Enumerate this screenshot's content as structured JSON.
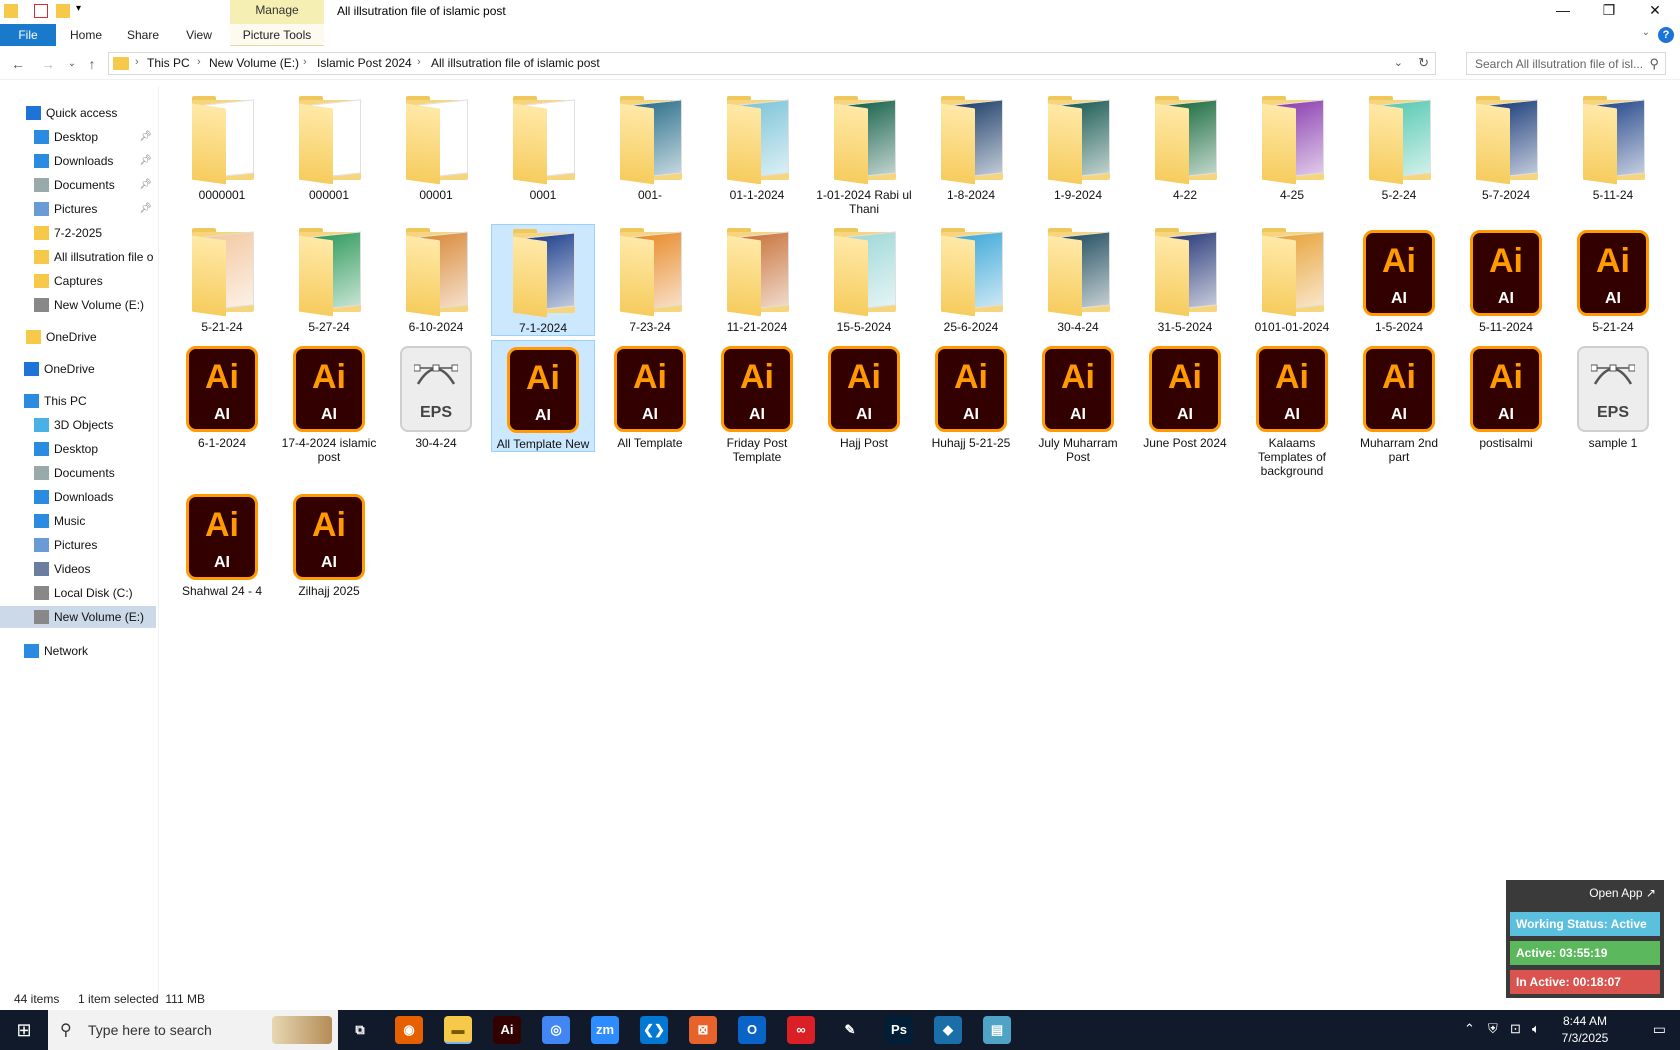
{
  "window": {
    "title": "All illsutration file of islamic post",
    "manage_tab": "Manage",
    "picture_tools": "Picture Tools",
    "minimize": "—",
    "restore": "❐",
    "close": "✕"
  },
  "ribbon": {
    "tabs": [
      "File",
      "Home",
      "Share",
      "View"
    ],
    "help": "?"
  },
  "address": {
    "crumbs": [
      "This PC",
      "New Volume (E:)",
      "Islamic Post 2024",
      "All illsutration file of islamic post"
    ],
    "search_placeholder": "Search All illsutration file of isl..."
  },
  "sidebar": {
    "items": [
      {
        "label": "Quick access",
        "icon": "star-icon",
        "pinned": false
      },
      {
        "label": "Desktop",
        "icon": "desktop-icon",
        "pinned": true
      },
      {
        "label": "Downloads",
        "icon": "download-icon",
        "pinned": true
      },
      {
        "label": "Documents",
        "icon": "documents-icon",
        "pinned": true
      },
      {
        "label": "Pictures",
        "icon": "pictures-icon",
        "pinned": true
      },
      {
        "label": "7-2-2025",
        "icon": "folder-icon",
        "pinned": false
      },
      {
        "label": "All illsutration file o",
        "icon": "folder-icon",
        "pinned": false
      },
      {
        "label": "Captures",
        "icon": "folder-icon",
        "pinned": false
      },
      {
        "label": "New Volume (E:)",
        "icon": "drive-icon",
        "pinned": false
      },
      {
        "label": "OneDrive",
        "icon": "folder-icon",
        "pinned": false
      },
      {
        "label": "OneDrive",
        "icon": "cloud-icon",
        "pinned": false
      },
      {
        "label": "This PC",
        "icon": "computer-icon",
        "pinned": false
      },
      {
        "label": "3D Objects",
        "icon": "cube-icon",
        "pinned": false
      },
      {
        "label": "Desktop",
        "icon": "desktop-icon",
        "pinned": false
      },
      {
        "label": "Documents",
        "icon": "documents-icon",
        "pinned": false
      },
      {
        "label": "Downloads",
        "icon": "download-icon",
        "pinned": false
      },
      {
        "label": "Music",
        "icon": "music-icon",
        "pinned": false
      },
      {
        "label": "Pictures",
        "icon": "pictures-icon",
        "pinned": false
      },
      {
        "label": "Videos",
        "icon": "video-icon",
        "pinned": false
      },
      {
        "label": "Local Disk (C:)",
        "icon": "drive-icon",
        "pinned": false
      },
      {
        "label": "New Volume (E:)",
        "icon": "drive-icon",
        "pinned": false,
        "selected": true
      },
      {
        "label": "Network",
        "icon": "network-icon",
        "pinned": false
      }
    ]
  },
  "files": [
    {
      "name": "0000001",
      "type": "folder"
    },
    {
      "name": "000001",
      "type": "folder"
    },
    {
      "name": "00001",
      "type": "folder"
    },
    {
      "name": "0001",
      "type": "folder"
    },
    {
      "name": "001-",
      "type": "folder",
      "thumb": "#2a6f8a"
    },
    {
      "name": "01-1-2024",
      "type": "folder",
      "thumb": "#7cc4d8"
    },
    {
      "name": "1-01-2024 Rabi ul Thani",
      "type": "folder",
      "thumb": "#16614a"
    },
    {
      "name": "1-8-2024",
      "type": "folder",
      "thumb": "#1f3f6b"
    },
    {
      "name": "1-9-2024",
      "type": "folder",
      "thumb": "#1a5a52"
    },
    {
      "name": "4-22",
      "type": "folder",
      "thumb": "#1b6b3f"
    },
    {
      "name": "4-25",
      "type": "folder",
      "thumb": "#8b3fb0"
    },
    {
      "name": "5-2-24",
      "type": "folder",
      "thumb": "#57c9b2"
    },
    {
      "name": "5-7-2024",
      "type": "folder",
      "thumb": "#1c3e7a"
    },
    {
      "name": "5-11-24",
      "type": "folder",
      "thumb": "#274a8c"
    },
    {
      "name": "5-21-24",
      "type": "folder",
      "thumb": "#f3c9a1"
    },
    {
      "name": "5-27-24",
      "type": "folder",
      "thumb": "#2f9a5c"
    },
    {
      "name": "6-10-2024",
      "type": "folder",
      "thumb": "#d98a3a"
    },
    {
      "name": "7-1-2024",
      "type": "folder",
      "thumb": "#1d3f8c",
      "selected": true
    },
    {
      "name": "7-23-24",
      "type": "folder",
      "thumb": "#e88a2a"
    },
    {
      "name": "11-21-2024",
      "type": "folder",
      "thumb": "#c8733b"
    },
    {
      "name": "15-5-2024",
      "type": "folder",
      "thumb": "#9fd8d8"
    },
    {
      "name": "25-6-2024",
      "type": "folder",
      "thumb": "#3ea8d8"
    },
    {
      "name": "30-4-24",
      "type": "folder",
      "thumb": "#234e5e"
    },
    {
      "name": "31-5-2024",
      "type": "folder",
      "thumb": "#2a3b7a"
    },
    {
      "name": "0101-01-2024",
      "type": "folder",
      "thumb": "#e8a33a"
    },
    {
      "name": "1-5-2024",
      "type": "ai"
    },
    {
      "name": "5-11-2024",
      "type": "ai"
    },
    {
      "name": "5-21-24",
      "type": "ai"
    },
    {
      "name": "6-1-2024",
      "type": "ai"
    },
    {
      "name": "17-4-2024 islamic post",
      "type": "ai"
    },
    {
      "name": "30-4-24",
      "type": "eps"
    },
    {
      "name": "All Template New",
      "type": "ai",
      "selected": true
    },
    {
      "name": "All Template",
      "type": "ai"
    },
    {
      "name": "Friday Post Template",
      "type": "ai"
    },
    {
      "name": "Hajj Post",
      "type": "ai"
    },
    {
      "name": "Huhajj 5-21-25",
      "type": "ai"
    },
    {
      "name": "July Muharram Post",
      "type": "ai"
    },
    {
      "name": "June Post 2024",
      "type": "ai"
    },
    {
      "name": "Kalaams Templates of background",
      "type": "ai"
    },
    {
      "name": "Muharram 2nd part",
      "type": "ai"
    },
    {
      "name": "postisalmi",
      "type": "ai"
    },
    {
      "name": "sample 1",
      "type": "eps"
    },
    {
      "name": "Shahwal 24 - 4",
      "type": "ai"
    },
    {
      "name": "Zilhajj 2025",
      "type": "ai"
    }
  ],
  "icon_text": {
    "ai_big": "Ai",
    "ai_small": "AI",
    "eps_small": "EPS"
  },
  "status": {
    "count": "44 items",
    "selection": "1 item selected  111 MB"
  },
  "widget": {
    "open_app": "Open App ↗",
    "working_status": "Working Status: Active",
    "active": "Active: 03:55:19",
    "inactive": "In Active: 00:18:07",
    "colors": {
      "status": "#5bc0de",
      "active": "#5cb85c",
      "inactive": "#d9534f"
    }
  },
  "taskbar": {
    "search_placeholder": "Type here to search",
    "apps": [
      {
        "name": "task-view",
        "glyph": "⧉",
        "color": "#101a2a"
      },
      {
        "name": "firefox",
        "glyph": "◉",
        "color": "#e66000"
      },
      {
        "name": "file-explorer",
        "glyph": "▬",
        "color": "#f6c94b",
        "active": true
      },
      {
        "name": "illustrator",
        "glyph": "Ai",
        "color": "#330000"
      },
      {
        "name": "chrome",
        "glyph": "◎",
        "color": "#4285f4"
      },
      {
        "name": "zoom",
        "glyph": "zm",
        "color": "#2d8cff"
      },
      {
        "name": "vscode",
        "glyph": "❮❯",
        "color": "#0078d4"
      },
      {
        "name": "app-orange",
        "glyph": "⊠",
        "color": "#e8632b"
      },
      {
        "name": "outlook",
        "glyph": "O",
        "color": "#0a64c8"
      },
      {
        "name": "creative-cloud",
        "glyph": "∞",
        "color": "#da1f26"
      },
      {
        "name": "pen-tool",
        "glyph": "✎",
        "color": "#101a2a"
      },
      {
        "name": "photoshop",
        "glyph": "Ps",
        "color": "#001e36"
      },
      {
        "name": "app-blue",
        "glyph": "◆",
        "color": "#1b6fa8"
      },
      {
        "name": "app-notes",
        "glyph": "▤",
        "color": "#4fa3c7"
      }
    ],
    "time": "8:44 AM",
    "date": "7/3/2025"
  }
}
